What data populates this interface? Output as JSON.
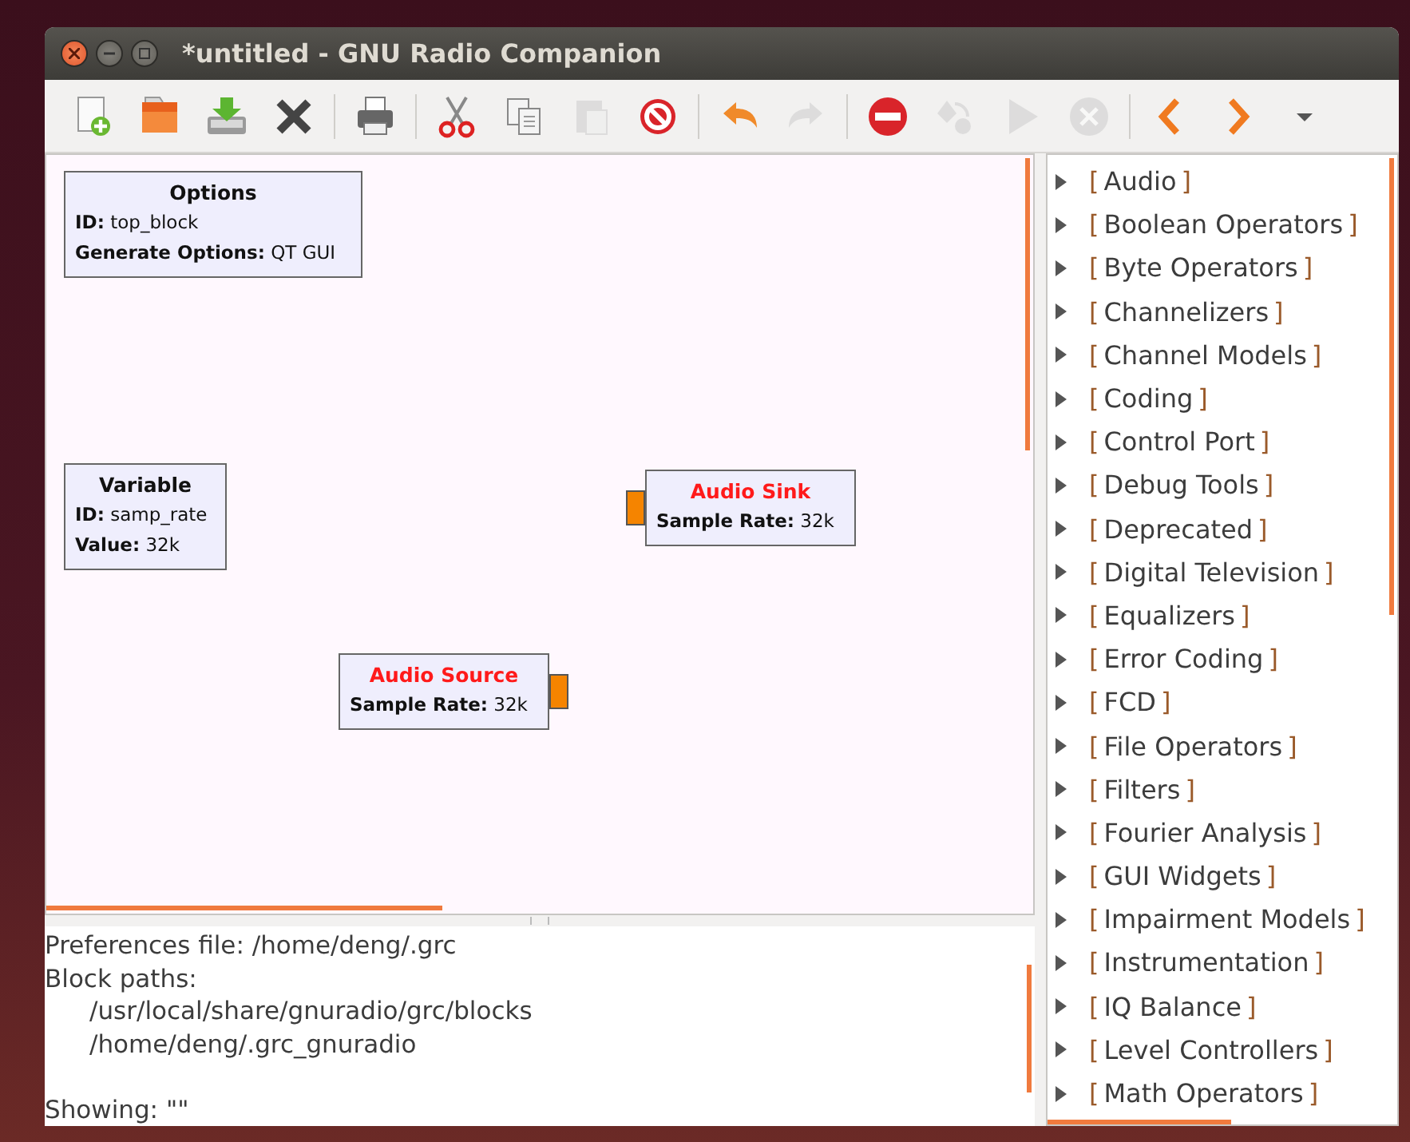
{
  "window": {
    "title": "*untitled - GNU Radio Companion"
  },
  "toolbar": [
    {
      "kind": "new",
      "disabled": false
    },
    {
      "kind": "open",
      "disabled": false
    },
    {
      "kind": "save",
      "disabled": false
    },
    {
      "kind": "close",
      "disabled": false
    },
    {
      "kind": "sep"
    },
    {
      "kind": "print",
      "disabled": false
    },
    {
      "kind": "sep"
    },
    {
      "kind": "cut",
      "disabled": false
    },
    {
      "kind": "copy",
      "disabled": false
    },
    {
      "kind": "paste",
      "disabled": true
    },
    {
      "kind": "delete",
      "disabled": false
    },
    {
      "kind": "sep"
    },
    {
      "kind": "undo",
      "disabled": false
    },
    {
      "kind": "redo",
      "disabled": true
    },
    {
      "kind": "sep"
    },
    {
      "kind": "kill",
      "disabled": false
    },
    {
      "kind": "generate",
      "disabled": true
    },
    {
      "kind": "execute",
      "disabled": true
    },
    {
      "kind": "stop",
      "disabled": true
    },
    {
      "kind": "sep"
    },
    {
      "kind": "prev",
      "disabled": false
    },
    {
      "kind": "next",
      "disabled": false
    },
    {
      "kind": "more",
      "disabled": false
    }
  ],
  "blocks": [
    {
      "title": "Options",
      "error": false,
      "params": [
        {
          "label": "ID:",
          "value": "top_block"
        },
        {
          "label": "Generate Options:",
          "value": "QT GUI"
        }
      ]
    },
    {
      "title": "Variable",
      "error": false,
      "params": [
        {
          "label": "ID:",
          "value": "samp_rate"
        },
        {
          "label": "Value:",
          "value": "32k"
        }
      ]
    },
    {
      "title": "Audio Sink",
      "error": true,
      "params": [
        {
          "label": "Sample Rate:",
          "value": "32k"
        }
      ],
      "ports": [
        {
          "kind": "in"
        }
      ]
    },
    {
      "title": "Audio Source",
      "error": true,
      "params": [
        {
          "label": "Sample Rate:",
          "value": "32k"
        }
      ],
      "ports": [
        {
          "kind": "out"
        }
      ]
    }
  ],
  "console": [
    {
      "kind": "line",
      "text": "Preferences file: /home/deng/.grc"
    },
    {
      "kind": "line",
      "text": "Block paths:"
    },
    {
      "kind": "path",
      "text": "/usr/local/share/gnuradio/grc/blocks"
    },
    {
      "kind": "path",
      "text": "/home/deng/.grc_gnuradio"
    },
    {
      "kind": "blank"
    },
    {
      "kind": "line",
      "text": "Showing: \"\""
    }
  ],
  "block_tree": [
    {
      "label": "Audio",
      "expanded": false
    },
    {
      "label": "Boolean Operators",
      "expanded": false
    },
    {
      "label": "Byte Operators",
      "expanded": false
    },
    {
      "label": "Channelizers",
      "expanded": false
    },
    {
      "label": "Channel Models",
      "expanded": false
    },
    {
      "label": "Coding",
      "expanded": false
    },
    {
      "label": "Control Port",
      "expanded": false
    },
    {
      "label": "Debug Tools",
      "expanded": false
    },
    {
      "label": "Deprecated",
      "expanded": false
    },
    {
      "label": "Digital Television",
      "expanded": false
    },
    {
      "label": "Equalizers",
      "expanded": false
    },
    {
      "label": "Error Coding",
      "expanded": false
    },
    {
      "label": "FCD",
      "expanded": false
    },
    {
      "label": "File Operators",
      "expanded": false
    },
    {
      "label": "Filters",
      "expanded": false
    },
    {
      "label": "Fourier Analysis",
      "expanded": false
    },
    {
      "label": "GUI Widgets",
      "expanded": false
    },
    {
      "label": "Impairment Models",
      "expanded": false
    },
    {
      "label": "Instrumentation",
      "expanded": false
    },
    {
      "label": "IQ Balance",
      "expanded": false
    },
    {
      "label": "Level Controllers",
      "expanded": false
    },
    {
      "label": "Math Operators",
      "expanded": false
    }
  ],
  "tree_brackets": {
    "open": "[",
    "close": "]"
  }
}
